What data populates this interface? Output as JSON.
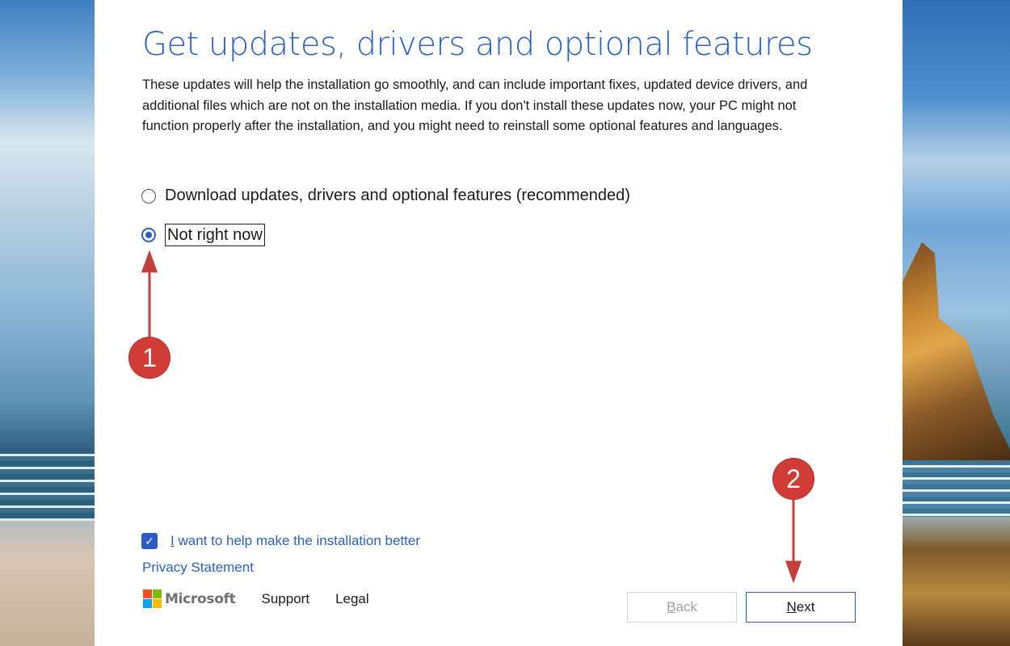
{
  "dialog": {
    "title": "Get updates, drivers and optional features",
    "description": "These updates will help the installation go smoothly, and can include important fixes, updated device drivers, and additional files which are not on the installation media. If you don't install these updates now, your PC might not function properly after the installation, and you might need to reinstall some optional features and languages.",
    "options": [
      {
        "label": "Download updates, drivers and optional features (recommended)",
        "selected": false
      },
      {
        "label": "Not right now",
        "selected": true
      }
    ],
    "help_checkbox": {
      "label_first": "I",
      "label_rest": " want to help make the installation better",
      "checked": true
    },
    "privacy_link": "Privacy Statement"
  },
  "footer": {
    "brand": "Microsoft",
    "links": [
      "Support",
      "Legal"
    ]
  },
  "buttons": {
    "back": {
      "mnemonic": "B",
      "rest": "ack",
      "enabled": false
    },
    "next": {
      "mnemonic": "N",
      "rest": "ext",
      "enabled": true
    }
  },
  "annotations": [
    {
      "number": "1"
    },
    {
      "number": "2"
    }
  ],
  "colors": {
    "accent": "#2b5cc3",
    "title": "#2b62c4",
    "annotation": "#d23c37"
  }
}
